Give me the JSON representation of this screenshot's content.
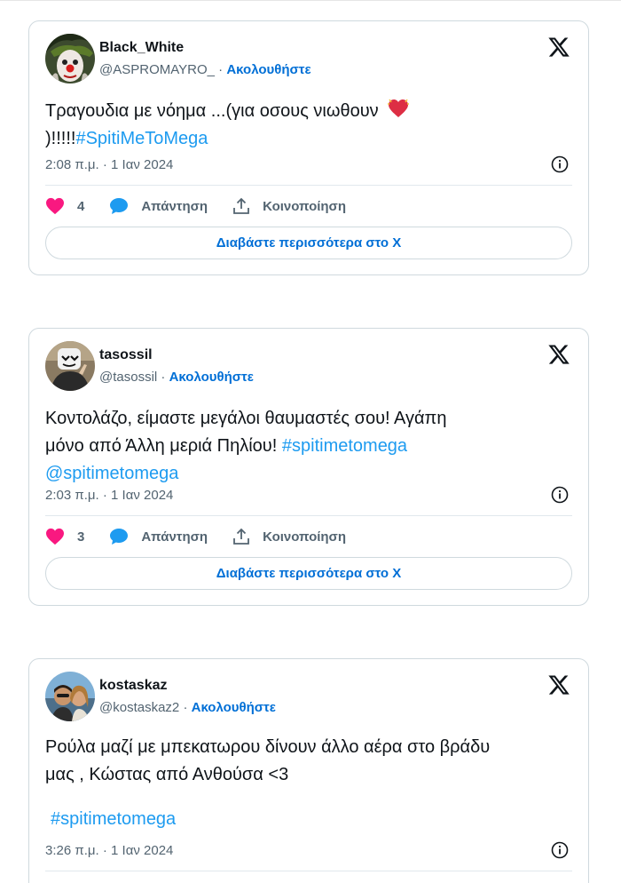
{
  "tweets": [
    {
      "username": "Black_White",
      "handle": "@ASPROMAYRO_",
      "follow_label": "Ακολουθήστε",
      "text_line1": "Τραγουδια με νόημα ...(για οσους νιωθουν",
      "text_line2_prefix": ")!!!!!",
      "hashtag": "#SpitiMeToMega",
      "timestamp": "2:08 π.μ. · 1 Ιαν 2024",
      "likes": "4",
      "reply_label": "Απάντηση",
      "share_label": "Κοινοποίηση",
      "read_more": "Διαβάστε περισσότερα στο X"
    },
    {
      "username": "tasossil",
      "handle": "@tasossil",
      "follow_label": "Ακολουθήστε",
      "text_line1": "Κοντολάζο, είμαστε μεγάλοι θαυμαστές σου! Αγάπη",
      "text_line2_prefix": "μόνο από Άλλη μεριά Πηλίου!",
      "hashtag": "#spitimetomega",
      "mention": "@spitimetomega",
      "timestamp": "2:03 π.μ. · 1 Ιαν 2024",
      "likes": "3",
      "reply_label": "Απάντηση",
      "share_label": "Κοινοποίηση",
      "read_more": "Διαβάστε περισσότερα στο X"
    },
    {
      "username": "kostaskaz",
      "handle": "@kostaskaz2",
      "follow_label": "Ακολουθήστε",
      "text_line1": "Ρούλα μαζί με μπεκατωρου δίνουν άλλο αέρα στο βράδυ",
      "text_line2": "μας , Κώστας από Ανθούσα <3",
      "hashtag": "#spitimetomega",
      "timestamp": "3:26 π.μ. · 1 Ιαν 2024"
    }
  ],
  "icons": {
    "x_logo": "x-logo-icon",
    "info": "info-icon",
    "heart": "heart-icon",
    "reply": "reply-bubble-icon",
    "share": "share-icon"
  },
  "colors": {
    "link": "#1d9bf0",
    "follow": "#006fd6",
    "heart": "#f91880",
    "muted": "#536471"
  }
}
